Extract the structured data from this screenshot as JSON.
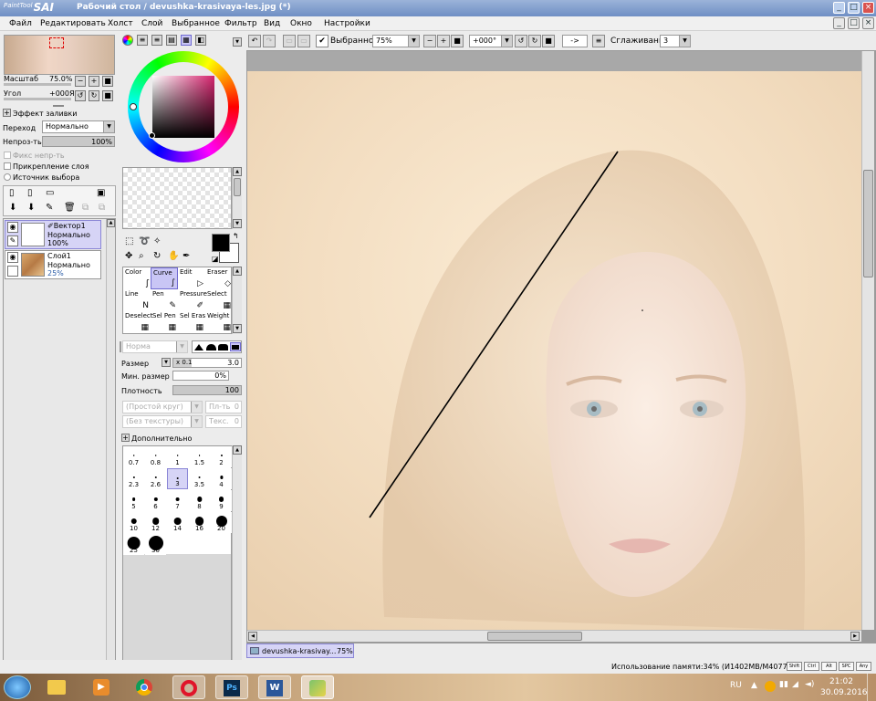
{
  "window": {
    "app_logo": "SAI",
    "app_logo_small": "PaintTool",
    "title": "Рабочий стол / devushka-krasivaya-les.jpg (*)",
    "controls": [
      "_",
      "□",
      "×"
    ]
  },
  "menu": [
    "Файл",
    "Редактировать",
    "Холст",
    "Слой",
    "Выбранное",
    "Фильтр",
    "Вид",
    "Окно",
    "Настройки"
  ],
  "toolbar": {
    "selected_label": "Выбранное",
    "zoom": "75%",
    "rotation": "+000°",
    "flip": "->",
    "smoothing_label": "Сглаживание",
    "smoothing_value": "3"
  },
  "navigator": {
    "scale_label": "Масштаб",
    "scale_value": "75.0%",
    "angle_label": "Угол",
    "angle_value": "+000Я"
  },
  "layer_props": {
    "fill_effect": "Эффект заливки",
    "blend_label": "Переход",
    "blend_value": "Нормально",
    "opacity_label": "Непроз-ть",
    "opacity_value": "100%",
    "opacity_fill": 1.0,
    "fix_opacity": "Фикс непр-ть",
    "clip_layer": "Прикрепление слоя",
    "selection_source": "Источник выбора"
  },
  "layers": [
    {
      "name": "Вектор1",
      "mode": "Нормально",
      "opacity": "100%",
      "selected": true
    },
    {
      "name": "Слой1",
      "mode": "Нормально",
      "opacity": "25%",
      "selected": false
    }
  ],
  "tools": [
    {
      "label": "Color",
      "icon": "color-tool-icon",
      "glyph": "ʃ"
    },
    {
      "label": "Curve",
      "icon": "curve-tool-icon",
      "glyph": "∫",
      "selected": true
    },
    {
      "label": "Edit",
      "icon": "edit-tool-icon",
      "glyph": "▷"
    },
    {
      "label": "Eraser",
      "icon": "eraser-tool-icon",
      "glyph": "◇"
    },
    {
      "label": "Line",
      "icon": "line-tool-icon",
      "glyph": "N"
    },
    {
      "label": "Pen",
      "icon": "pen-tool-icon",
      "glyph": "✎"
    },
    {
      "label": "Pressure",
      "icon": "pressure-tool-icon",
      "glyph": "✐"
    },
    {
      "label": "Select",
      "icon": "select-tool-icon",
      "glyph": "▦"
    },
    {
      "label": "Deselect",
      "icon": "deselect-tool-icon",
      "glyph": "▦"
    },
    {
      "label": "Sel Pen",
      "icon": "sel-pen-tool-icon",
      "glyph": "▦"
    },
    {
      "label": "Sel Eras",
      "icon": "sel-eraser-tool-icon",
      "glyph": "▦"
    },
    {
      "label": "Weight",
      "icon": "weight-tool-icon",
      "glyph": "▦"
    }
  ],
  "brush": {
    "mode": "Норма",
    "size_label": "Размер",
    "size_mult": "x 0.1",
    "size_value": "3.0",
    "min_size_label": "Мин. размер",
    "min_size_value": "0%",
    "density_label": "Плотность",
    "density_value": "100",
    "shape": "(Простой круг)",
    "shape_strength": "Пл-ть",
    "shape_value": "0",
    "texture": "(Без текстуры)",
    "texture_strength": "Текс.",
    "texture_value": "0",
    "advanced": "Дополнительно",
    "sizes": [
      "0.7",
      "0.8",
      "1",
      "1.5",
      "2",
      "2.3",
      "2.6",
      "3",
      "3.5",
      "4",
      "5",
      "6",
      "7",
      "8",
      "9",
      "10",
      "12",
      "14",
      "16",
      "20",
      "25",
      "30"
    ],
    "selected_size": "3"
  },
  "document_tab": {
    "name": "devushka-krasivay...",
    "zoom": "75%"
  },
  "status": {
    "memory": "Использование памяти:34% (И1402MB/M4077MB)",
    "keys": [
      "Shift",
      "Ctrl",
      "Alt",
      "SPC",
      "Any"
    ]
  },
  "taskbar": {
    "apps": [
      "start-orb",
      "explorer",
      "media-player",
      "chrome",
      "opera",
      "photoshop",
      "word",
      "paint-tool-sai"
    ],
    "lang": "RU",
    "time": "21:02",
    "date": "30.09.2016"
  },
  "colors": {
    "accent": "#6f6ad0",
    "selection": "#c9c6f5",
    "titlebar": "#7f9dce"
  }
}
